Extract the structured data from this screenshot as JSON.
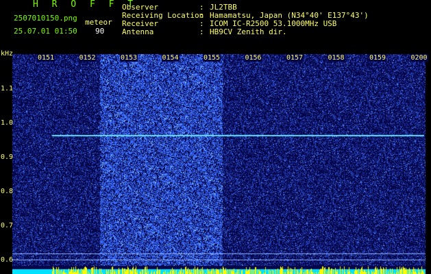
{
  "header": {
    "title": "H R O F F T",
    "filename": "2507010150.png",
    "datetime": "25.07.01 01:50",
    "meteor_label": "meteor",
    "meteor_count": "90",
    "fields": [
      {
        "label": "Observer",
        "value": "JL2TBB"
      },
      {
        "label": "Receiving Location",
        "value": "Hamamatsu, Japan (N34°40' E137°43')"
      },
      {
        "label": "Receiver",
        "value": "ICOM IC-R2500 53.1000MHz USB"
      },
      {
        "label": "Antenna",
        "value": "HB9CV Zenith dir."
      }
    ]
  },
  "spectrogram": {
    "freq_unit": "kHz",
    "y_ticks": [
      "1.1",
      "1.0",
      "0.9",
      "0.8",
      "0.7",
      "0.6"
    ],
    "x_ticks": [
      "0151",
      "0152",
      "0153",
      "0154",
      "0155",
      "0156",
      "0157",
      "0158",
      "0159",
      "0200"
    ],
    "carrier_freq_khz": 0.965,
    "colors": {
      "background": "#06064a",
      "noise": "#3a6cff",
      "carrier": "#66e0ff",
      "baseline": "#00e0ff",
      "spikes": "#ffff00"
    }
  }
}
